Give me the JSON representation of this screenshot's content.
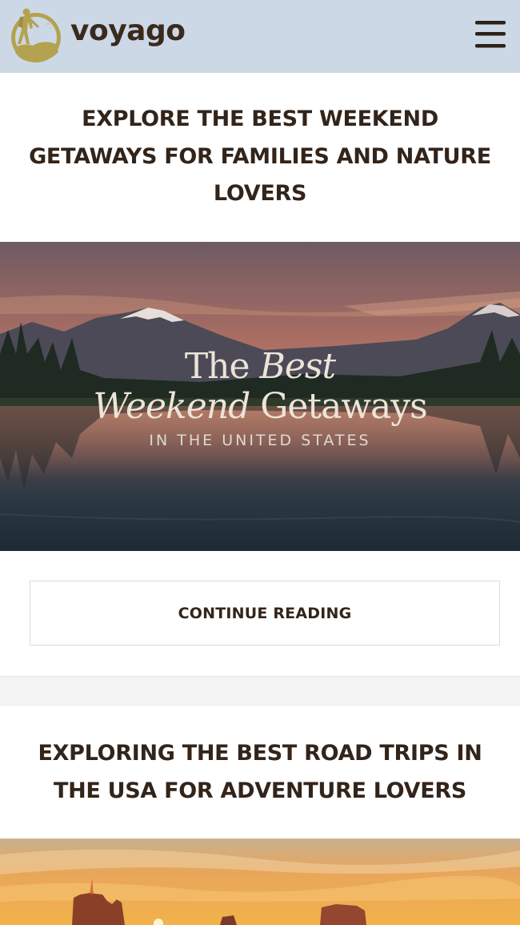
{
  "header": {
    "logo_text": "voyago",
    "colors": {
      "background": "#cdd8e6",
      "logo_gold": "#b3a350",
      "text": "#3a2a1e"
    },
    "menu_icon": "hamburger-menu-icon"
  },
  "posts": [
    {
      "title": "EXPLORE THE BEST WEEKEND GETAWAYS FOR FAMILIES AND NATURE LOVERS",
      "image_overlay": {
        "line1_a": "The ",
        "line1_b": "Best",
        "line2_a": "Weekend",
        "line2_b": " Getaways",
        "line3": "IN THE UNITED STATES"
      },
      "button_label": "CONTINUE READING"
    },
    {
      "title": "EXPLORING THE BEST ROAD TRIPS IN THE USA FOR ADVENTURE LOVERS"
    }
  ]
}
